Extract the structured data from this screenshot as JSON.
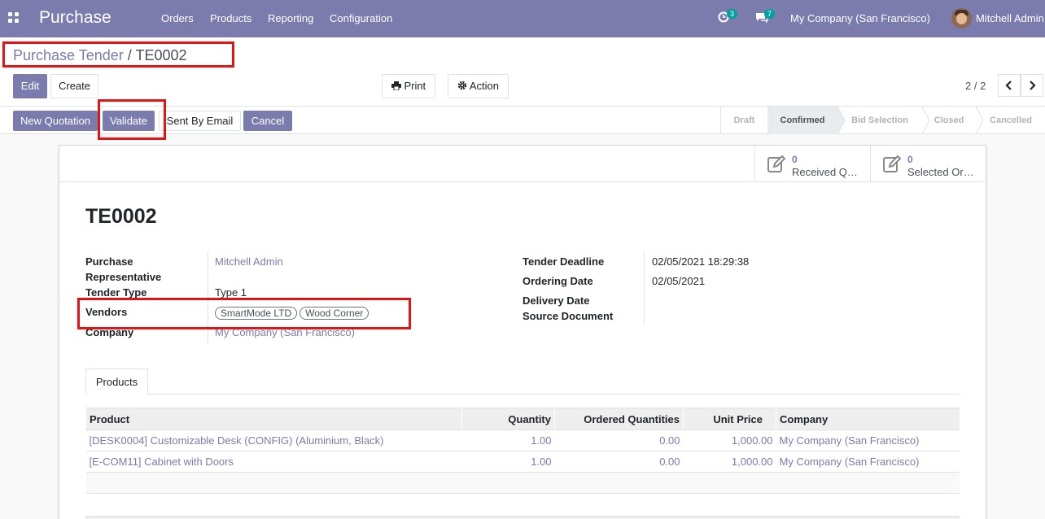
{
  "navbar": {
    "app_name": "Purchase",
    "menu": [
      "Orders",
      "Products",
      "Reporting",
      "Configuration"
    ],
    "activity_count": "3",
    "message_count": "7",
    "company": "My Company (San Francisco)",
    "user": "Mitchell Admin"
  },
  "breadcrumb": {
    "parent": "Purchase Tender",
    "separator": "/",
    "current": "TE0002"
  },
  "toolbar": {
    "edit": "Edit",
    "create": "Create",
    "print": "Print",
    "action": "Action",
    "pager": "2 / 2"
  },
  "header_buttons": {
    "new_quotation": "New Quotation",
    "validate": "Validate",
    "sent_by_email": "Sent By Email",
    "cancel": "Cancel"
  },
  "stages": [
    "Draft",
    "Confirmed",
    "Bid Selection",
    "Closed",
    "Cancelled"
  ],
  "active_stage": "Confirmed",
  "smart_buttons": [
    {
      "value": "0",
      "label": "Received Quotations"
    },
    {
      "value": "0",
      "label": "Selected Orders"
    }
  ],
  "form": {
    "title": "TE0002",
    "left": {
      "purchase_rep_label": "Purchase Representative",
      "purchase_rep_value": "Mitchell Admin",
      "tender_type_label": "Tender Type",
      "tender_type_value": "Type 1",
      "vendors_label": "Vendors",
      "vendors": [
        "SmartMode LTD",
        "Wood Corner"
      ],
      "company_label": "Company",
      "company_value": "My Company (San Francisco)"
    },
    "right": {
      "deadline_label": "Tender Deadline",
      "deadline_value": "02/05/2021 18:29:38",
      "ordering_date_label": "Ordering Date",
      "ordering_date_value": "02/05/2021",
      "delivery_date_label": "Delivery Date",
      "source_doc_label": "Source Document"
    },
    "tab": "Products",
    "table": {
      "columns": [
        "Product",
        "Quantity",
        "Ordered Quantities",
        "Unit Price",
        "Company"
      ],
      "rows": [
        [
          "[DESK0004] Customizable Desk (CONFIG) (Aluminium, Black)",
          "1.00",
          "0.00",
          "1,000.00",
          "My Company (San Francisco)"
        ],
        [
          "[E-COM11] Cabinet with Doors",
          "1.00",
          "0.00",
          "1,000.00",
          "My Company (San Francisco)"
        ]
      ]
    }
  },
  "colors": {
    "brand": "#7c7bad",
    "highlight": "#e31414",
    "badge": "#00a09d"
  }
}
